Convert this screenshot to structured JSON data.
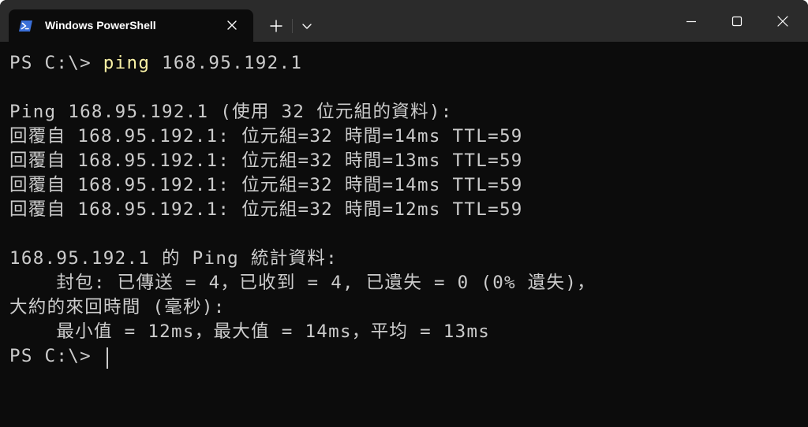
{
  "window": {
    "tab_title": "Windows PowerShell",
    "icons": {
      "app": "powershell-icon",
      "tab_close": "close-icon",
      "new_tab": "plus-icon",
      "dropdown": "chevron-down-icon",
      "minimize": "minimize-icon",
      "maximize": "maximize-icon",
      "close": "close-icon"
    }
  },
  "terminal": {
    "prompt1": "PS C:\\> ",
    "command": "ping",
    "command_args": " 168.95.192.1",
    "lines": [
      "Ping 168.95.192.1 (使用 32 位元組的資料):",
      "回覆自 168.95.192.1: 位元組=32 時間=14ms TTL=59",
      "回覆自 168.95.192.1: 位元組=32 時間=13ms TTL=59",
      "回覆自 168.95.192.1: 位元組=32 時間=14ms TTL=59",
      "回覆自 168.95.192.1: 位元組=32 時間=12ms TTL=59",
      "168.95.192.1 的 Ping 統計資料:",
      "    封包: 已傳送 = 4，已收到 = 4, 已遺失 = 0 (0% 遺失)，",
      "大約的來回時間 (毫秒):",
      "    最小值 = 12ms，最大值 = 14ms，平均 = 13ms"
    ],
    "prompt2": "PS C:\\> "
  },
  "colors": {
    "background": "#0c0c0c",
    "titlebar": "#2b2b2b",
    "text": "#cccccc",
    "command": "#f9f1a5",
    "powershell_blue": "#3a6fd8"
  }
}
